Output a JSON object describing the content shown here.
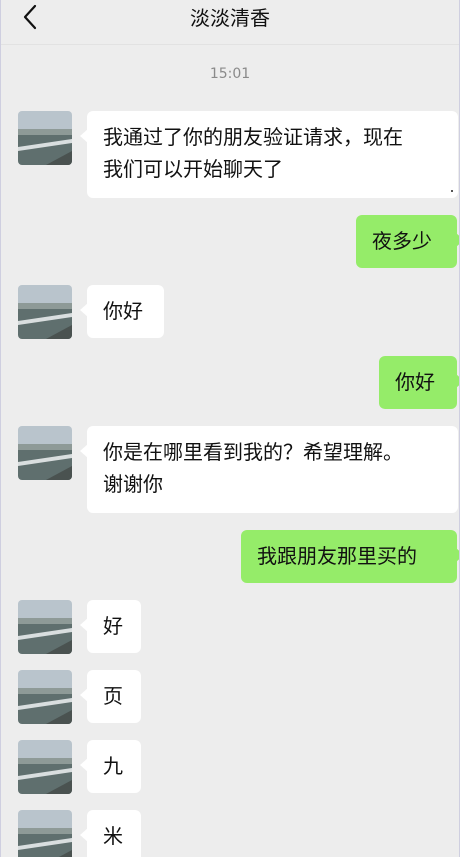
{
  "header": {
    "title": "淡淡清香",
    "back_icon": "chevron-left-icon"
  },
  "timestamp": "15:01",
  "contact_avatar_icon": "lake-scenery-avatar",
  "colors": {
    "background": "#ededed",
    "incoming_bubble": "#ffffff",
    "outgoing_bubble": "#95ec69"
  },
  "messages": [
    {
      "direction": "in",
      "lines": [
        "我通过了你的朋友验证请求，现在",
        "我们可以开始聊天了"
      ]
    },
    {
      "direction": "out",
      "lines": [
        "夜多少"
      ]
    },
    {
      "direction": "in",
      "lines": [
        "你好"
      ]
    },
    {
      "direction": "out",
      "lines": [
        "你好"
      ]
    },
    {
      "direction": "in",
      "lines": [
        "你是在哪里看到我的？希望理解。",
        "谢谢你"
      ]
    },
    {
      "direction": "out",
      "lines": [
        "我跟朋友那里买的"
      ]
    },
    {
      "direction": "in",
      "lines": [
        "好"
      ]
    },
    {
      "direction": "in",
      "lines": [
        "页"
      ]
    },
    {
      "direction": "in",
      "lines": [
        "九"
      ]
    },
    {
      "direction": "in",
      "lines": [
        "米"
      ]
    }
  ]
}
